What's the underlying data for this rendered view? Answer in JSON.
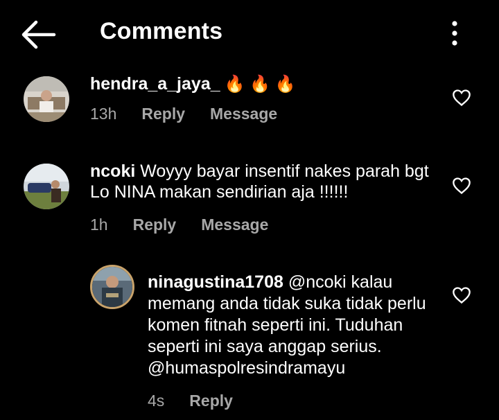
{
  "header": {
    "title": "Comments"
  },
  "comments": [
    {
      "username": "hendra_a_jaya_",
      "text": "",
      "emoji": "🔥 🔥 🔥",
      "time": "13h",
      "reply_label": "Reply",
      "message_label": "Message"
    },
    {
      "username": "ncoki",
      "text": " Woyyy bayar insentif nakes parah bgt Lo NINA makan sendirian aja !!!!!!",
      "time": "1h",
      "reply_label": "Reply",
      "message_label": "Message"
    },
    {
      "username": "ninagustina1708",
      "text": " @ncoki kalau memang anda tidak suka tidak perlu komen fitnah seperti ini. Tuduhan seperti ini saya anggap serius. @humaspolresindramayu",
      "time": "4s",
      "reply_label": "Reply"
    }
  ],
  "colors": {
    "background": "#000000",
    "text": "#ffffff",
    "meta": "#a8a8a8",
    "story_ring": "#c9a36b"
  },
  "icons": {
    "back": "arrow-left-icon",
    "more": "more-vertical-icon",
    "like": "heart-outline-icon"
  }
}
